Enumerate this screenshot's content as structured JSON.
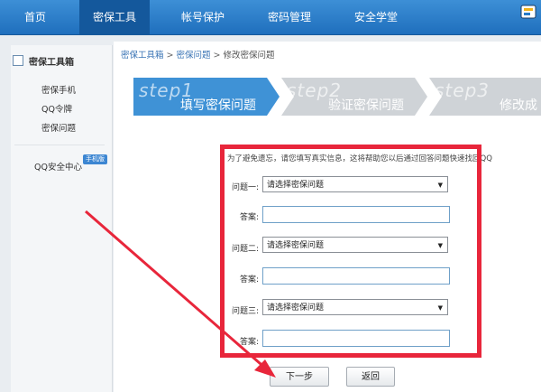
{
  "topnav": {
    "items": [
      "首页",
      "密保工具",
      "帐号保护",
      "密码管理",
      "安全学堂"
    ],
    "active_index": 1
  },
  "sidebar": {
    "title": "密保工具箱",
    "links": [
      "密保手机",
      "QQ令牌",
      "密保问题"
    ],
    "qq_center": "QQ安全中心",
    "badge": "手机版"
  },
  "breadcrumb": [
    "密保工具箱",
    "密保问题",
    "修改密保问题"
  ],
  "steps": [
    {
      "en": "step1",
      "cn": "填写密保问题",
      "active": true
    },
    {
      "en": "step2",
      "cn": "验证密保问题",
      "active": false
    },
    {
      "en": "step3",
      "cn": "修改成",
      "active": false
    }
  ],
  "form": {
    "intro": "为了避免遗忘，请您填写真实信息，这将帮助您以后通过回答问题快速找回QQ",
    "question1_label": "问题一:",
    "question2_label": "问题二:",
    "question3_label": "问题三:",
    "answer_label": "答案:",
    "select_placeholder": "请选择密保问题",
    "next_button": "下一步",
    "back_button": "返回"
  },
  "colors": {
    "nav": "#2a7cc8",
    "highlight": "#e8263b",
    "step_active": "#3f92d6",
    "step_inactive": "#cfd3d7"
  }
}
